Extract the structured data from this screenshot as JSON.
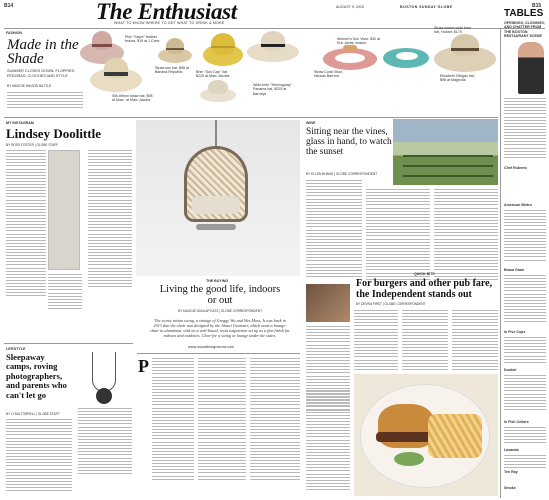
{
  "header": {
    "page_left": "B14",
    "masthead": "The Enthusiast",
    "tagline": "WHAT TO KNOW WHERE TO GET WHAT TO DRINK & MORE",
    "date_small": "AUGUST 9, 2015",
    "paper_name": "BOSTON SUNDAY GLOBE",
    "page_right": "B15"
  },
  "left_feature": {
    "kicker": "FASHION",
    "title": "Made in the Shade",
    "deck": "SUMMER CLOSES DOWN: FLOPPIES, FEDORAS, CLOCHES AND STYLE",
    "byline": "BY MAGGIE WILSON BATTLE"
  },
  "hat_captions": [
    "Pink \"Sayre\" feather fedora, $19 at J.Crew",
    "Silk-ribbon straw hat, $98 at Marc, at Marc Jacobs",
    "Straw sun hat, $98 at Banana Republic",
    "Brim \"Sun Cap\" hat, $225 at Marc Jacobs",
    "Wide-brim \"Hemingway\" Panama hat, $225 at Barneys",
    "Straw Coral Visor, Nicolas Barrera",
    "Women's Sun Visor, $30 at Eric Javits, boston",
    "Straw woven wide brim hat, Hobart, $175",
    "Elizabeth Gilligan hat, $98 at Magnolia"
  ],
  "profile": {
    "kicker": "MY INSTAGRAM",
    "title": "Lindsey Doolittle",
    "byline": "BY ROSS FOSTER | GLOBE STAFF"
  },
  "lifestyle": {
    "kicker": "LIFESTYLE",
    "title": "Sleepaway camps, roving photographers, and parents who can't let go",
    "byline": "BY LYDIA TORRELL | GLOBE STAFF"
  },
  "center_feature": {
    "kicker": "THE BUYING",
    "title": "Living the good life, indoors or out",
    "byline": "BY MAGGIE DUNLAP KATZ | GLOBE CORRESPONDENT",
    "caption": "The iconic rattan swing, a vintage of Greggy Wu and Wes Moss. It was back in 2013 that the chair was designed by the Alauri Grassner, which seats a lounge-chair in aluminum, sold on a web-based, resin suspension set up as a fine finish for indoors and outdoors. Clear for a swing or lounge under the stairs.",
    "url": "www.wooddesignsnow.com"
  },
  "wine": {
    "kicker": "WINE",
    "title": "Sitting near the vines, glass in hand, to watch the sunset",
    "byline": "BY ELLEN BHANG | GLOBE CORRESPONDENT"
  },
  "quick_bite": {
    "kicker": "QUICK BITE",
    "title": "For burgers and other pub fare, the Independent stands out",
    "byline": "BY DEVRA FIRST | GLOBE CORRESPONDENT"
  },
  "tables": {
    "title": "TABLES",
    "deck": "OPENINGS, CLOSINGS, AND CHATTER FROM THE BOSTON RESTAURANT SCENE",
    "subheads": [
      "Chef Roberto",
      "American Bistro",
      "Brasa Gram",
      "In Five Cups",
      "Dunkin'",
      "In Fish Cellars",
      "Lavanda",
      "Ten Ray",
      "Smoke"
    ]
  },
  "colors": {
    "masthead": "#111111",
    "kicker_red": "#b8322a",
    "rule": "#999999",
    "body_text": "#bbbbbb"
  }
}
